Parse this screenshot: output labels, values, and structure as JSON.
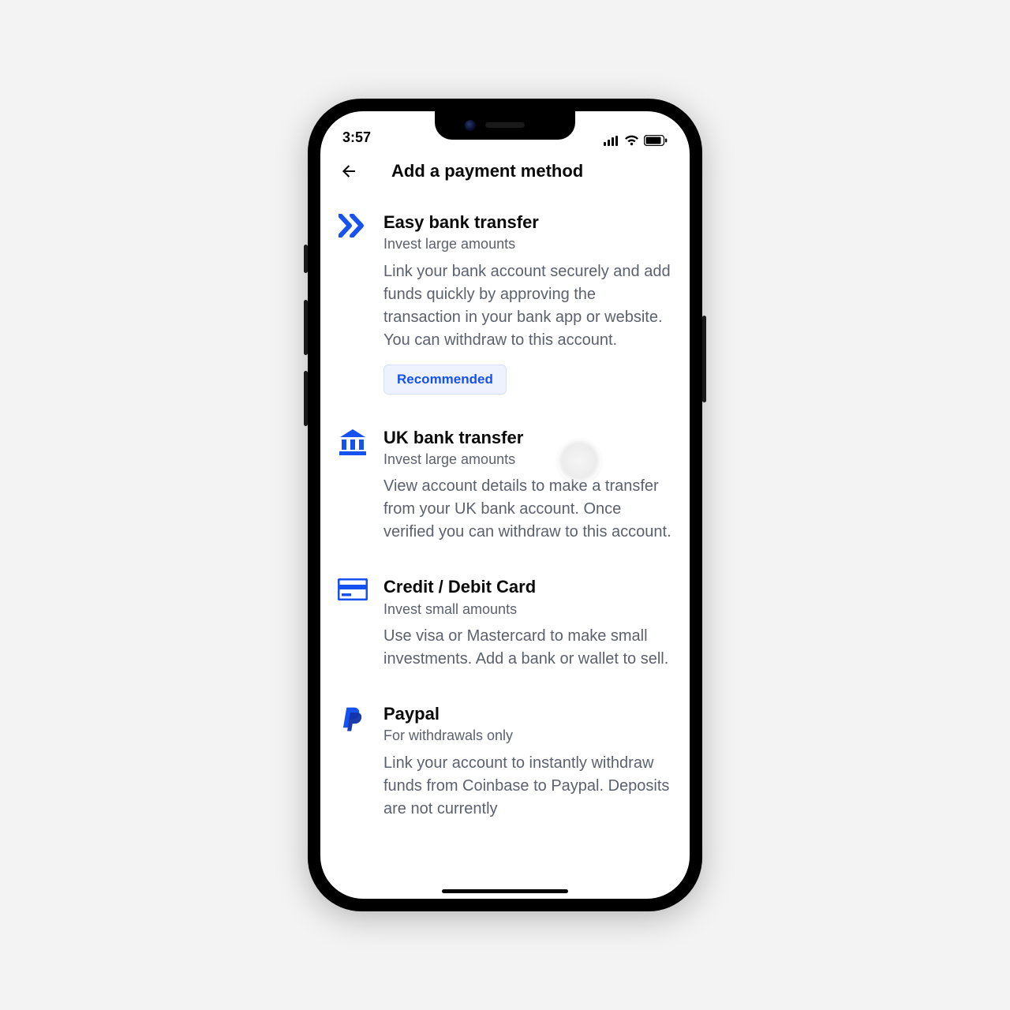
{
  "status": {
    "time": "3:57"
  },
  "header": {
    "title": "Add a payment method"
  },
  "methods": [
    {
      "icon": "chevrons-right",
      "title": "Easy bank transfer",
      "sub": "Invest large amounts",
      "desc": "Link your bank account securely and add funds quickly by approving the transaction in your bank app or website. You can withdraw to this account.",
      "badge": "Recommended"
    },
    {
      "icon": "bank",
      "title": "UK bank transfer",
      "sub": "Invest large amounts",
      "desc": "View account details to make a transfer from your UK bank account. Once verified you can withdraw to this account."
    },
    {
      "icon": "card",
      "title": "Credit / Debit Card",
      "sub": "Invest small amounts",
      "desc": "Use visa or Mastercard to make small investments. Add a bank or wallet to sell."
    },
    {
      "icon": "paypal",
      "title": "Paypal",
      "sub": "For withdrawals only",
      "desc": "Link your account to instantly withdraw funds from Coinbase to Paypal. Deposits are not currently"
    }
  ],
  "colors": {
    "accent": "#1652f0"
  }
}
